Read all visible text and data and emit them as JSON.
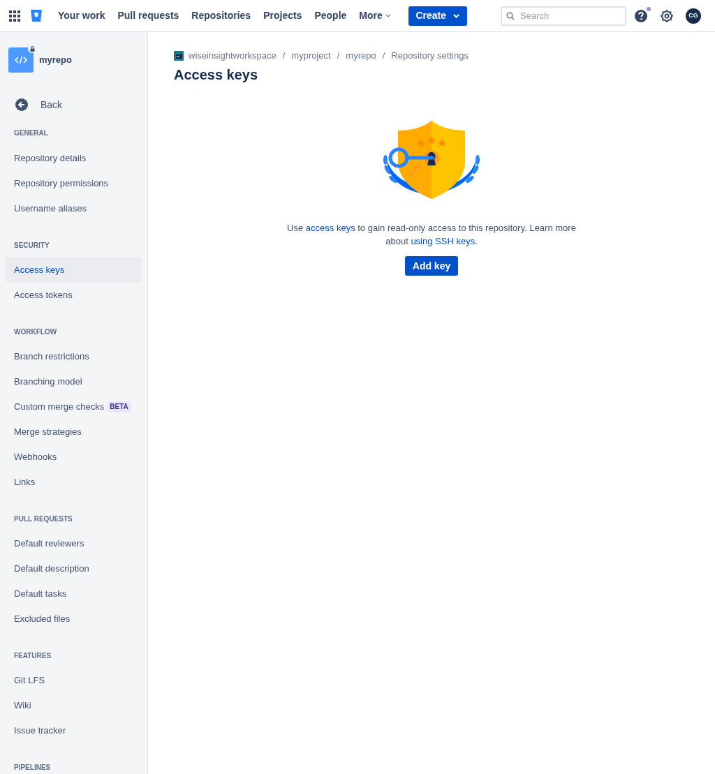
{
  "top_nav": {
    "items": [
      {
        "label": "Your work",
        "kind": "link"
      },
      {
        "label": "Pull requests",
        "kind": "link"
      },
      {
        "label": "Repositories",
        "kind": "link"
      },
      {
        "label": "Projects",
        "kind": "link"
      },
      {
        "label": "People",
        "kind": "link"
      },
      {
        "label": "More",
        "kind": "dropdown"
      }
    ],
    "create_button": "Create",
    "search": {
      "placeholder": "Search"
    },
    "help_notification": true,
    "avatar": "CG"
  },
  "sidebar": {
    "repo_name": "myrepo",
    "private": true,
    "back": "Back",
    "sections": [
      {
        "title": "GENERAL",
        "items": [
          {
            "label": "Repository details",
            "selected": false
          },
          {
            "label": "Repository permissions",
            "selected": false
          },
          {
            "label": "Username aliases",
            "selected": false
          }
        ]
      },
      {
        "title": "SECURITY",
        "items": [
          {
            "label": "Access keys",
            "selected": true
          },
          {
            "label": "Access tokens",
            "selected": false
          }
        ]
      },
      {
        "title": "WORKFLOW",
        "items": [
          {
            "label": "Branch restrictions",
            "selected": false
          },
          {
            "label": "Branching model",
            "selected": false
          },
          {
            "label": "Custom merge checks",
            "selected": false,
            "badge": "BETA"
          },
          {
            "label": "Merge strategies",
            "selected": false
          },
          {
            "label": "Webhooks",
            "selected": false
          },
          {
            "label": "Links",
            "selected": false
          }
        ]
      },
      {
        "title": "PULL REQUESTS",
        "items": [
          {
            "label": "Default reviewers",
            "selected": false
          },
          {
            "label": "Default description",
            "selected": false
          },
          {
            "label": "Default tasks",
            "selected": false
          },
          {
            "label": "Excluded files",
            "selected": false
          }
        ]
      },
      {
        "title": "FEATURES",
        "items": [
          {
            "label": "Git LFS",
            "selected": false
          },
          {
            "label": "Wiki",
            "selected": false
          },
          {
            "label": "Issue tracker",
            "selected": false
          }
        ]
      },
      {
        "title": "PIPELINES"
      }
    ]
  },
  "breadcrumbs": [
    {
      "label": "wiseinsightworkspace"
    },
    {
      "separator": "/",
      "label": "myproject"
    },
    {
      "separator": "/",
      "label": "myrepo"
    },
    {
      "separator": "/",
      "label": "Repository settings"
    }
  ],
  "page_title": "Access keys",
  "empty_state": {
    "parts": [
      {
        "text": "Use ",
        "kind": "text"
      },
      {
        "text": "access keys",
        "kind": "link"
      },
      {
        "text": " to gain read-only access to this repository. Learn more about ",
        "kind": "text"
      },
      {
        "text": "using SSH keys",
        "kind": "link"
      },
      {
        "text": ".",
        "kind": "text"
      }
    ],
    "button": "Add key"
  }
}
